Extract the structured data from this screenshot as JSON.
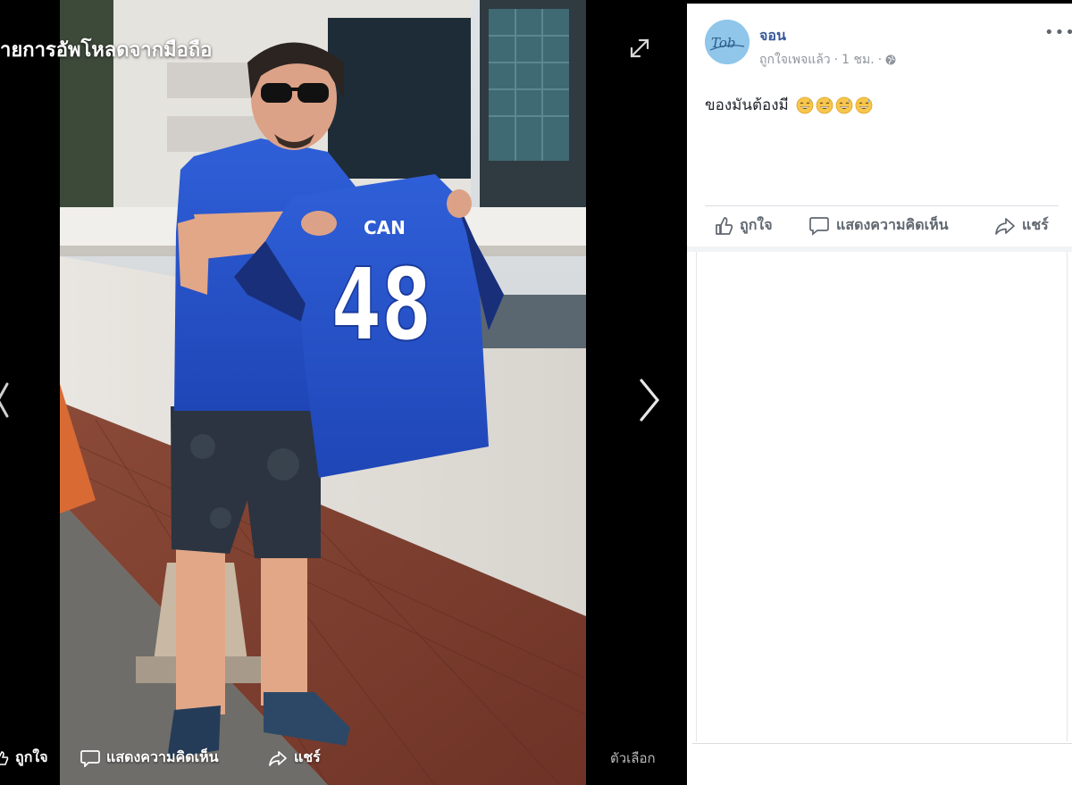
{
  "viewer": {
    "album_title": "ายการอัพโหลดจากมือถือ",
    "photo": {
      "jersey_name": "CAN",
      "jersey_number": "48"
    },
    "actions": {
      "like_label": "ถูกใจ",
      "comment_label": "แสดงความคิดเห็น",
      "share_label": "แชร์"
    },
    "options_label": "ตัวเลือก"
  },
  "post": {
    "author": "จอน",
    "avatar_text": "Tob",
    "activity": "ถูกใจเพจแล้ว",
    "time": "1 ชม.",
    "text": "ของมันต้องมี",
    "emoji_count": 4,
    "actions": {
      "like_label": "ถูกใจ",
      "comment_label": "แสดงความคิดเห็น",
      "share_label": "แชร์"
    }
  },
  "colors": {
    "author_link": "#365899",
    "jersey_blue": "#2a5bd7",
    "muted_text": "#90949c",
    "action_text": "#606770"
  }
}
